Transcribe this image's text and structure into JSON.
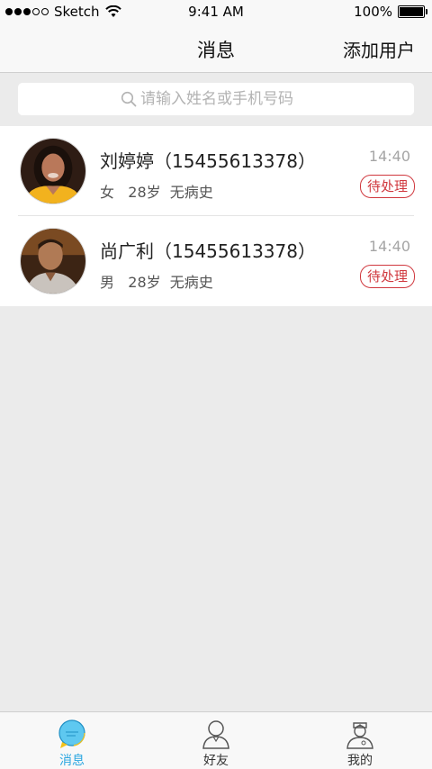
{
  "status_bar": {
    "carrier": "Sketch",
    "time": "9:41 AM",
    "battery": "100%"
  },
  "nav": {
    "title": "消息",
    "action_label": "添加用户"
  },
  "search": {
    "placeholder": "请输入姓名或手机号码"
  },
  "messages": [
    {
      "name": "刘婷婷（15455613378）",
      "detail": "女   28岁  无病史",
      "time": "14:40",
      "status": "待处理",
      "avatar": "avatar-woman"
    },
    {
      "name": "尚广利（15455613378）",
      "detail": "男   28岁  无病史",
      "time": "14:40",
      "status": "待处理",
      "avatar": "avatar-man"
    }
  ],
  "tabs": [
    {
      "label": "消息",
      "icon": "chat-bubble-icon",
      "active": true
    },
    {
      "label": "好友",
      "icon": "person-icon",
      "active": false
    },
    {
      "label": "我的",
      "icon": "doctor-icon",
      "active": false
    }
  ],
  "colors": {
    "accent": "#2aa6e0",
    "badge": "#d0383e",
    "background": "#ebebeb"
  }
}
